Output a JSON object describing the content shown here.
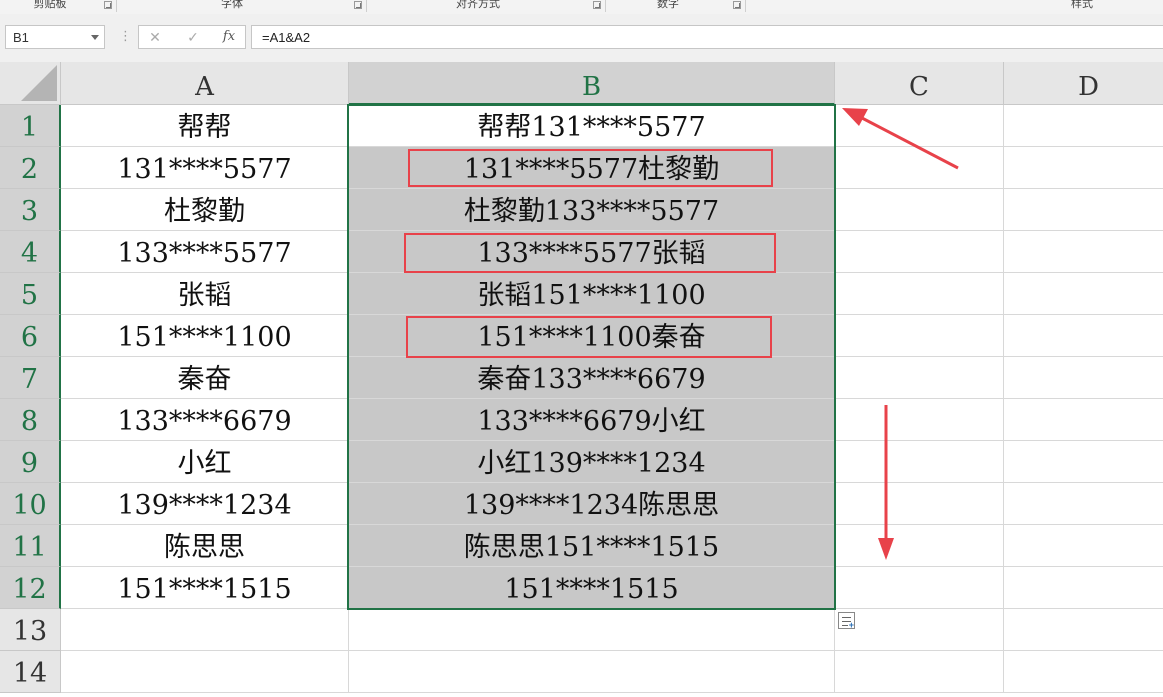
{
  "ribbon": {
    "groups": [
      "剪贴板",
      "字体",
      "对齐方式",
      "数字",
      "样式"
    ]
  },
  "formula_bar": {
    "name_box": "B1",
    "cancel_glyph": "✕",
    "enter_glyph": "✓",
    "fx_label": "fx",
    "formula": "=A1&A2"
  },
  "columns": [
    "A",
    "B",
    "C",
    "D"
  ],
  "rows": [
    "1",
    "2",
    "3",
    "4",
    "5",
    "6",
    "7",
    "8",
    "9",
    "10",
    "11",
    "12",
    "13",
    "14"
  ],
  "cells": {
    "A": [
      "帮帮",
      "131****5577",
      "杜黎勤",
      "133****5577",
      "张韬",
      "151****1100",
      "秦奋",
      "133****6679",
      "小红",
      "139****1234",
      "陈思思",
      "151****1515"
    ],
    "B": [
      "帮帮131****5577",
      "131****5577杜黎勤",
      "杜黎勤133****5577",
      "133****5577张韬",
      "张韬151****1100",
      "151****1100秦奋",
      "秦奋133****6679",
      "133****6679小红",
      "小红139****1234",
      "139****1234陈思思",
      "陈思思151****1515",
      "151****1515"
    ]
  },
  "selection": {
    "range": "B1:B12",
    "highlighted_rows_b": [
      "2",
      "3",
      "4",
      "5",
      "6",
      "7",
      "8",
      "9",
      "10",
      "11",
      "12"
    ]
  },
  "annotations": {
    "red_boxes_on_rows": [
      "2",
      "4",
      "6"
    ],
    "arrow_color": "#e8424a"
  },
  "colors": {
    "accent": "#217346",
    "highlight": "#c8c8c8",
    "annotation": "#e8424a"
  }
}
